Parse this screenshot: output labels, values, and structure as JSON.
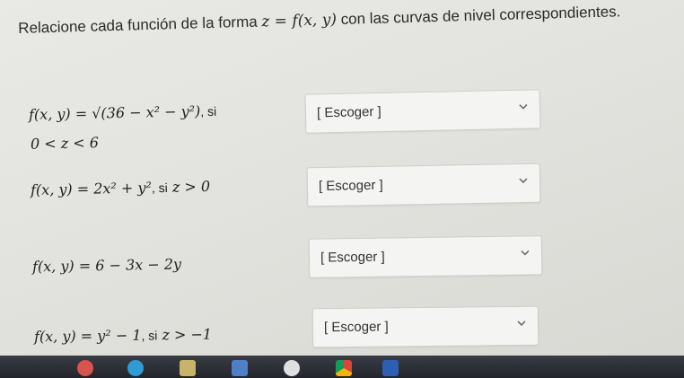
{
  "question": {
    "prefix": "Relacione cada función de la forma ",
    "math": "z = f(x, y)",
    "suffix": " con las curvas de nivel correspondientes."
  },
  "rows": [
    {
      "formula": "f(x, y) = √(36 − x² − y²)",
      "condition_word": ", si",
      "condition_math": "0 < z < 6",
      "select_value": "[ Escoger ]"
    },
    {
      "formula": "f(x, y) = 2x² + y²",
      "condition_word": ", si",
      "condition_math": "z > 0",
      "select_value": "[ Escoger ]"
    },
    {
      "formula": "f(x, y) = 6 − 3x − 2y",
      "condition_word": "",
      "condition_math": "",
      "select_value": "[ Escoger ]"
    },
    {
      "formula": "f(x, y) = y² − 1",
      "condition_word": ", si",
      "condition_math": "z > −1",
      "select_value": "[ Escoger ]"
    }
  ],
  "taskbar": {
    "icons": [
      "app-icon",
      "app-icon",
      "app-icon",
      "calculator-icon",
      "app-icon",
      "chrome-icon",
      "word-icon"
    ]
  }
}
